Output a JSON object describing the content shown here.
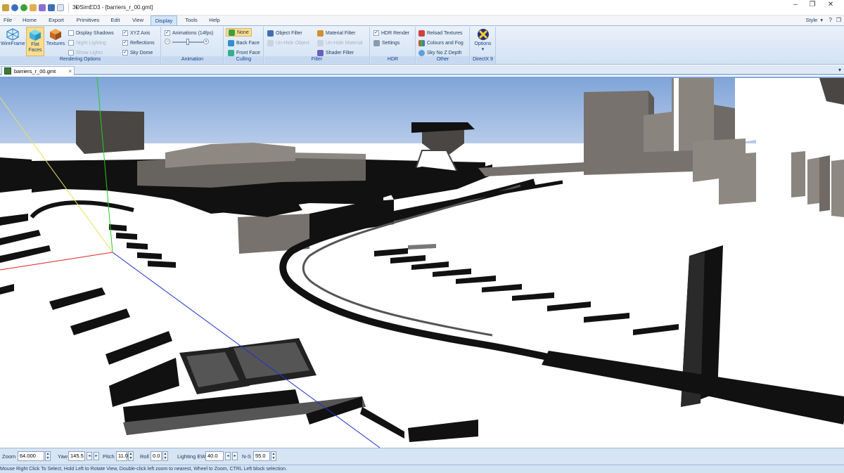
{
  "window": {
    "title": "3DSimED3 - [barriers_r_00.gmt]",
    "controls": [
      "–",
      "❐",
      "✕"
    ]
  },
  "qat_icons": [
    "app-icon",
    "undo-icon",
    "redo-icon",
    "open-icon",
    "image-icon",
    "save-icon",
    "save-as-icon"
  ],
  "menu": {
    "tabs": [
      "File",
      "Home",
      "Export",
      "Primitives",
      "Edit",
      "View",
      "Display",
      "Tools",
      "Help"
    ],
    "active": "Display",
    "style_label": "Style",
    "style_arrow": "▾",
    "help_icon": "?",
    "restore_icon": "❐"
  },
  "ribbon": {
    "rendering": {
      "label": "Rendering Options",
      "wireframe": "WireFrame",
      "flat_faces": "Flat Faces",
      "textures": "Textures",
      "display_shadows": "Display Shadows",
      "night_lighting": "Night Lighting",
      "show_lights": "Show Lights",
      "xyz_axis": "XYZ Axis",
      "reflections": "Reflections",
      "sky_dome": "Sky Dome"
    },
    "animation": {
      "label": "Animation",
      "animations": "Animations (14fps)",
      "minus": "−",
      "plus": "+"
    },
    "culling": {
      "label": "Culling",
      "none": "None",
      "back_face": "Back Face",
      "front_face": "Front Face"
    },
    "filter": {
      "label": "Filter",
      "object_filter": "Object Filter",
      "unhide_object": "Un-Hide Object",
      "material_filter": "Material Filter",
      "unhide_material": "Un-Hide Material",
      "shader_filter": "Shader Filter"
    },
    "hdr": {
      "label": "HDR",
      "hdr_render": "HDR Render",
      "settings": "Settings"
    },
    "other": {
      "label": "Other",
      "reload_textures": "Reload Textures",
      "colours_fog": "Colours and Fog",
      "sky_no_z": "Sky No Z Depth"
    },
    "directx": {
      "label": "DirectX 9",
      "options": "Options",
      "arrow": "▾"
    },
    "check": "✓"
  },
  "document": {
    "tab": "barriers_r_00.gmt",
    "close": "×",
    "dropdown": "▾"
  },
  "scene": {
    "sky_color": "#93b3e0",
    "ground_color": "#ffffff",
    "building_color": "#77726d",
    "dark_color": "#111111",
    "axis_x": "#e02020",
    "axis_y": "#22cc22",
    "axis_z": "#2030d0",
    "axis_yellow": "#e8e060"
  },
  "controls": {
    "zoom_label": "Zoom",
    "zoom": "64.000",
    "yaw_label": "Yaw",
    "yaw": "145.5",
    "pitch_label": "Pitch",
    "pitch": "11.0",
    "roll_label": "Roll",
    "roll": "0.0",
    "lighting_label": "Lighting EW",
    "lighting": "40.0",
    "ns_label": "N-S",
    "ns": "55.0",
    "spin_up": "▲",
    "spin_down": "▼",
    "arrow_left": "◂",
    "arrow_right": "▸"
  },
  "status": {
    "text": "Mouse Right Click To Select, Hold Left to Rotate View, Double-click left  zoom to nearest, Wheel to Zoom, CTRL Left block selection."
  }
}
